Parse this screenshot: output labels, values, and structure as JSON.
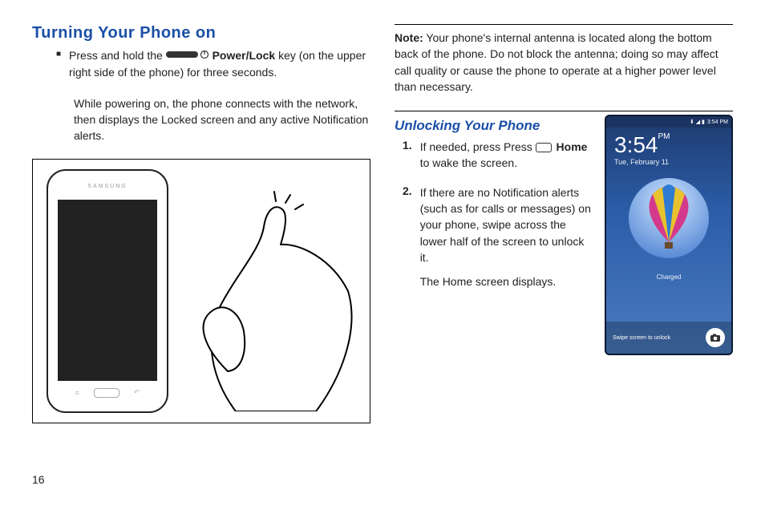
{
  "left": {
    "heading": "Turning Your Phone on",
    "bullet_pre": "Press and hold the ",
    "power_key_label": "Power/Lock",
    "bullet_post": " key (on the upper right side of the phone) for three seconds.",
    "para2": "While powering on, the phone connects with the network, then displays the Locked screen and any active Notification alerts.",
    "phone_brand": "SAMSUNG"
  },
  "right": {
    "note_label": "Note:",
    "note_text": " Your phone's internal antenna is located along the bottom back of the phone. Do not block the antenna; doing so may affect call quality or cause the phone to operate at a higher power level than necessary.",
    "subheading": "Unlocking Your Phone",
    "step1_num": "1.",
    "step1_pre": "If needed, press Press ",
    "step1_home": "Home",
    "step1_post": " to wake the screen.",
    "step2_num": "2.",
    "step2_text": "If there are no Notification alerts (such as for calls or messages) on your phone, swipe across the lower half of the screen to unlock it.",
    "step2_after": "The Home screen displays."
  },
  "screenshot": {
    "status_time": "3:54 PM",
    "status_icons": "⬇ ◢ ▮",
    "time": "3:54",
    "pm": "PM",
    "date": "Tue, February 11",
    "charged": "Charged",
    "swipe_hint": "Swipe screen to unlock"
  },
  "page_number": "16"
}
